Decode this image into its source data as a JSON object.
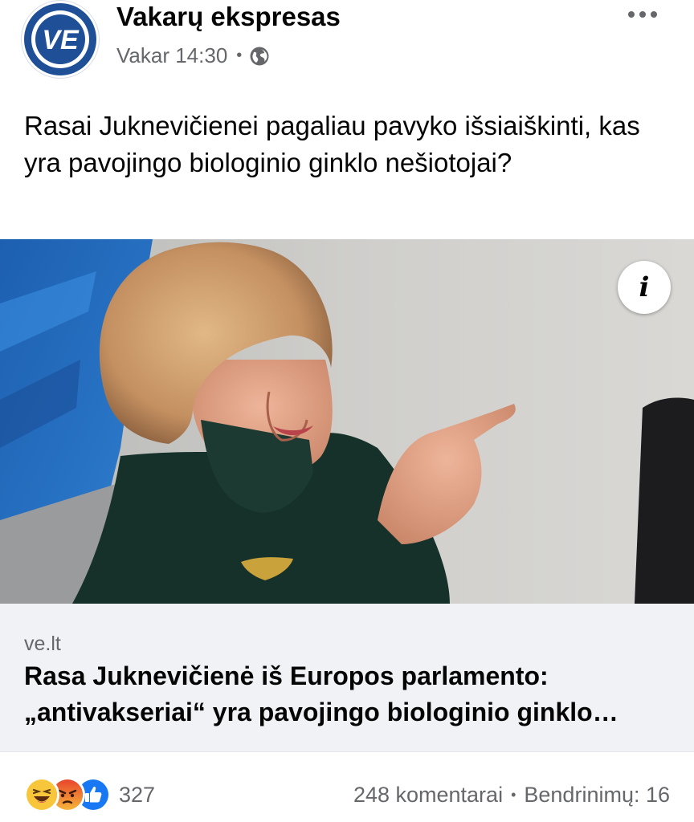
{
  "post": {
    "page_name": "Vakarų ekspresas",
    "time": "Vakar 14:30",
    "separator": "•",
    "avatar_logo_text": "VE",
    "text": "Rasai Juknevičienei pagaliau pavyko išsiaiškinti, kas yra pavojingo biologinio ginklo nešiotojai?",
    "info_icon_glyph": "i"
  },
  "link": {
    "domain": "ve.lt",
    "title": "Rasa Juknevičienė iš Europos parlamento: „antivakseriai“ yra pavojingo biologinio ginklo…"
  },
  "footer": {
    "reaction_count": "327",
    "comments": "248 komentarai",
    "separator": "•",
    "shares": "Bendrinimų: 16"
  },
  "icons": {
    "avatar": "vakaru-ekspresas-logo",
    "more": "more-horizontal-icon",
    "globe": "globe-icon",
    "info": "info-icon",
    "reactions": [
      "haha-reaction-icon",
      "angry-reaction-icon",
      "like-reaction-icon"
    ]
  },
  "colors": {
    "logo_blue": "#1f4f97",
    "muted_text": "#65676b",
    "link_bg": "#f0f2f5",
    "like_blue": "#1877f2",
    "haha_yellow": "#f7c63a",
    "angry_orange": "#f0682b"
  }
}
